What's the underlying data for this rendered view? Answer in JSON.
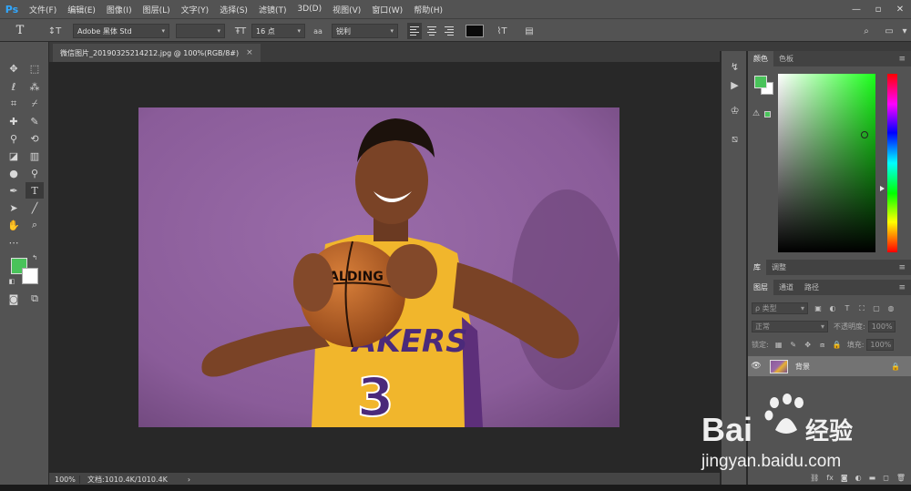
{
  "app": {
    "logo": "Ps"
  },
  "menu": [
    "文件(F)",
    "编辑(E)",
    "图像(I)",
    "图层(L)",
    "文字(Y)",
    "选择(S)",
    "滤镜(T)",
    "3D(D)",
    "视图(V)",
    "窗口(W)",
    "帮助(H)"
  ],
  "window_controls": [
    "—",
    "▫",
    "✕"
  ],
  "options": {
    "tool_glyph": "T",
    "font_family": "Adobe 黑体 Std",
    "font_style": "",
    "font_size": "16 点",
    "aa_label": "aa",
    "antialias": "锐利",
    "text_color": "#0a0a0a"
  },
  "document": {
    "tab_title": "微信图片_20190325214212.jpg @ 100%(RGB/8#)",
    "close": "×"
  },
  "status": {
    "zoom": "100%",
    "doc_size": "文档:1010.4K/1010.4K",
    "arrow": "›"
  },
  "colors": {
    "foreground": "#49c35a",
    "background": "#ffffff"
  },
  "panels": {
    "color_tabs": [
      "颜色",
      "色板"
    ],
    "library_tabs": [
      "库",
      "调整"
    ],
    "layers_tabs": [
      "图层",
      "通道",
      "路径"
    ],
    "layers": {
      "filter_placeholder": "ρ 类型",
      "blend_mode": "正常",
      "opacity_label": "不透明度:",
      "opacity_value": "100%",
      "lock_label": "锁定:",
      "fill_label": "填充:",
      "fill_value": "100%",
      "items": [
        {
          "name": "背景",
          "visible": true,
          "locked": true
        }
      ]
    }
  },
  "watermark": {
    "brand": "Bai",
    "brand_cn": "经验",
    "url": "jingyan.baidu.com"
  }
}
